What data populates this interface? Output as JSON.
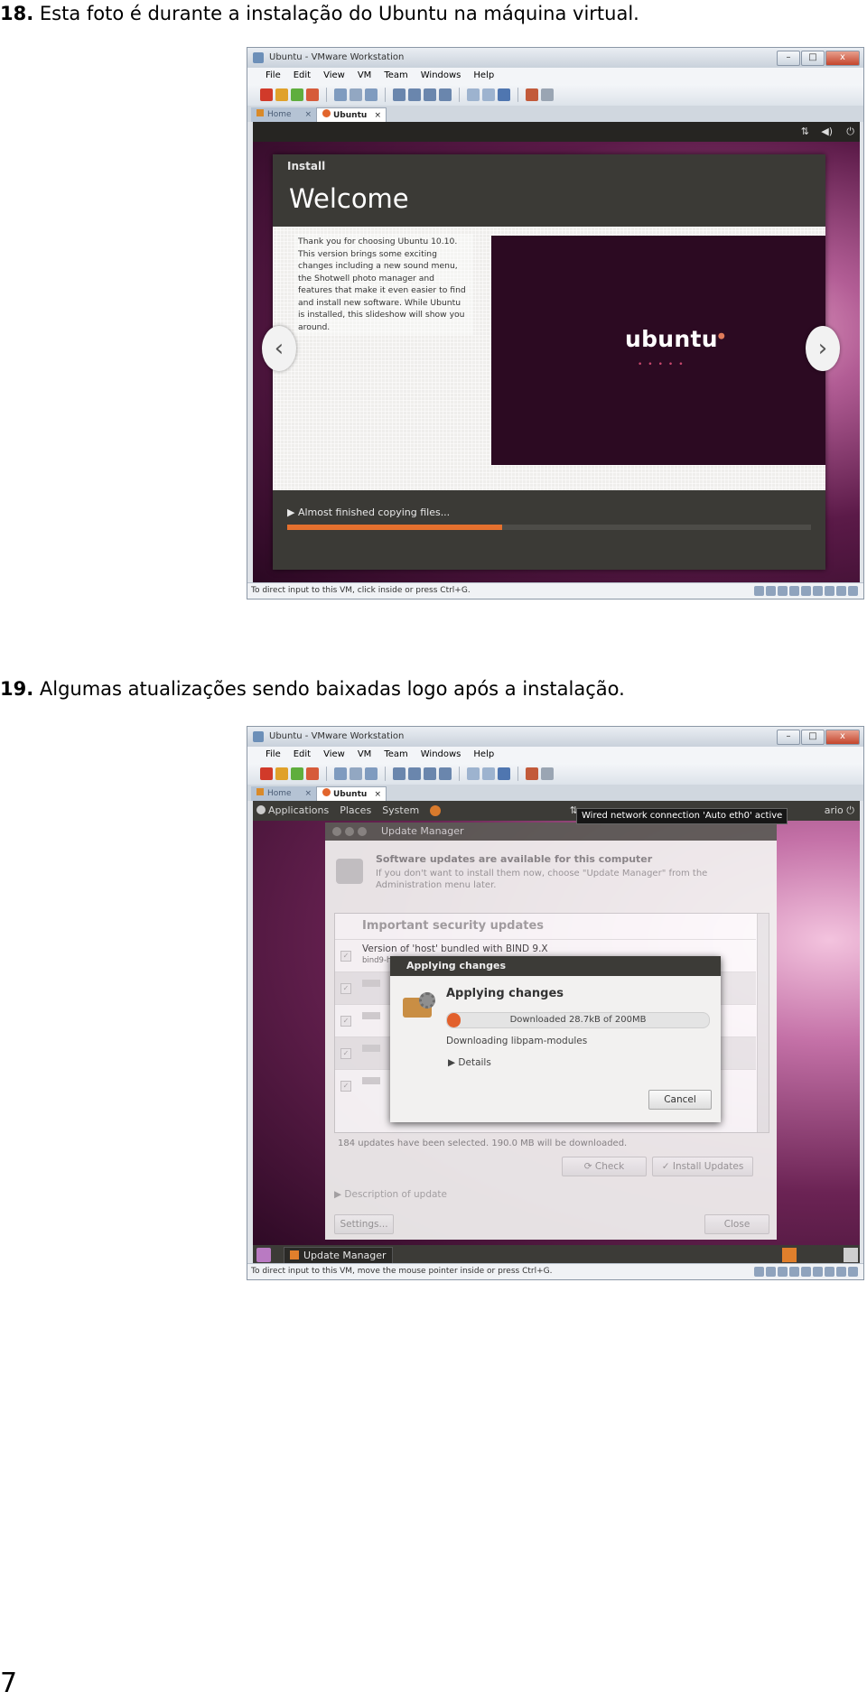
{
  "captions": [
    {
      "number": "18.",
      "text": " Esta foto é durante a instalação do Ubuntu na máquina virtual."
    },
    {
      "number": "19.",
      "text": " Algumas atualizações sendo baixadas logo após a instalação."
    }
  ],
  "page_number": "7",
  "vmware": {
    "window_title": "Ubuntu - VMware Workstation",
    "menu": [
      "File",
      "Edit",
      "View",
      "VM",
      "Team",
      "Windows",
      "Help"
    ],
    "tabs": {
      "home": "Home",
      "vm": "Ubuntu",
      "close": "×"
    },
    "window_buttons": {
      "minimize": "–",
      "maximize": "□",
      "close": "x"
    }
  },
  "screenshot1": {
    "installer": {
      "section": "Install",
      "title": "Welcome",
      "body": "Thank you for choosing Ubuntu 10.10. This version brings some exciting changes including a new sound menu, the Shotwell photo manager and features that make it even easier to find and install new software. While Ubuntu is installed, this slideshow will show you around.",
      "slide_logo": "ubuntu",
      "prev_arrow": "‹",
      "next_arrow": "›",
      "progress_text": "▶ Almost finished copying files...",
      "progress_fraction": 0.41
    },
    "status_text": "To direct input to this VM, click inside or press Ctrl+G."
  },
  "screenshot2": {
    "panel": {
      "applications": "Applications",
      "places": "Places",
      "system": "System",
      "user_trunc": "ario"
    },
    "tooltip": "Wired network connection 'Auto eth0' active",
    "update_manager": {
      "title": "Update Manager",
      "headline": "Software updates are available for this computer",
      "subtext": "If you don't want to install them now, choose \"Update Manager\" from the Administration menu later.",
      "category": "Important security updates",
      "first_update": "Version of 'host' bundled with BIND 9.X",
      "first_update_sub": "bind9-host (Size: 64 KB)",
      "count_text": "184 updates have been selected. 190.0 MB will be downloaded.",
      "check_button": "Check",
      "install_button": "Install Updates",
      "description_toggle": "▶ Description of update",
      "settings_button": "Settings...",
      "close_button": "Close"
    },
    "applying_dialog": {
      "title": "Applying changes",
      "heading": "Applying changes",
      "progress_text": "Downloaded 28.7kB of 200MB",
      "progress_fraction": 0.05,
      "status": "Downloading libpam-modules",
      "details": "▶ Details",
      "cancel": "Cancel"
    },
    "taskbar_item": "Update Manager",
    "status_text": "To direct input to this VM, move the mouse pointer inside or press Ctrl+G."
  }
}
